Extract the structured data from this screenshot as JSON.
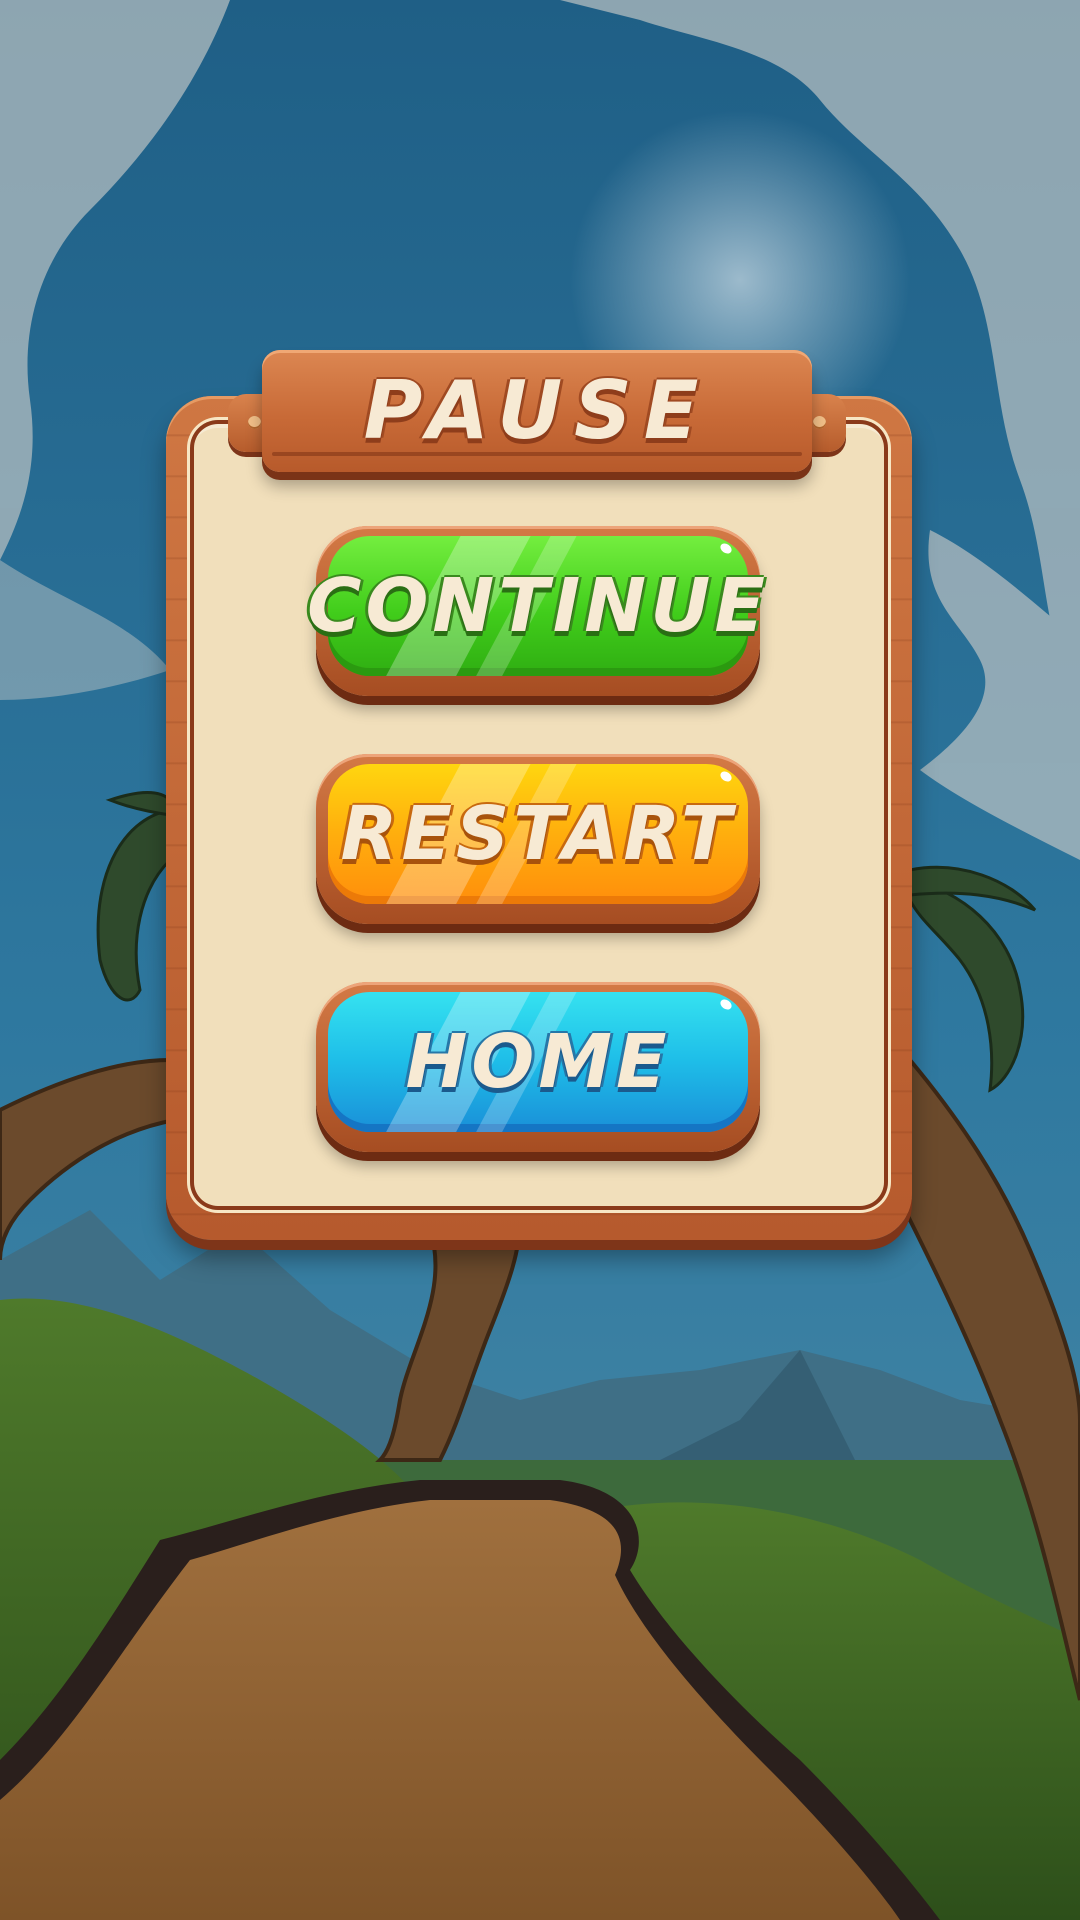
{
  "screen": "pause-menu",
  "header": {
    "title": "PAUSE"
  },
  "buttons": {
    "continue": {
      "label": "CONTINUE",
      "color": "#41cd1b"
    },
    "restart": {
      "label": "RESTART",
      "color": "#ffae0d"
    },
    "home": {
      "label": "HOME",
      "color": "#1ebde8"
    }
  },
  "colors": {
    "panel_wood": "#c86a37",
    "panel_paper": "#f1dfbb",
    "label_text": "#f7ead4",
    "sky": "#2a6a8f"
  }
}
